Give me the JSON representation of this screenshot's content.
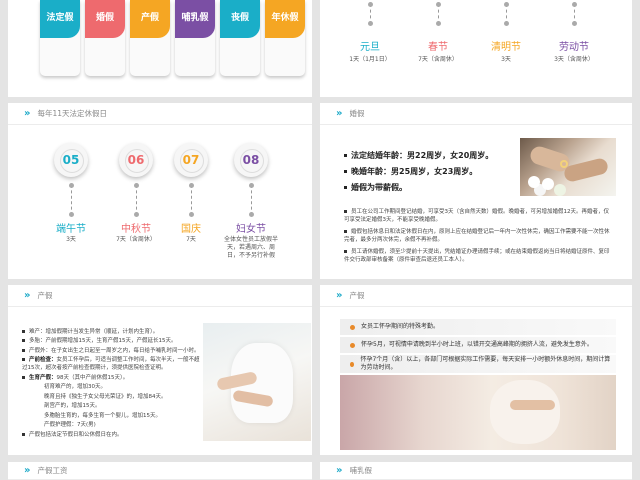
{
  "slide1": {
    "tags": [
      {
        "label": "法定假",
        "color": "#1aaec8"
      },
      {
        "label": "婚假",
        "color": "#ee6a6e"
      },
      {
        "label": "产假",
        "color": "#f5a623"
      },
      {
        "label": "哺乳假",
        "color": "#7b4fa4"
      },
      {
        "label": "丧假",
        "color": "#1aaec8"
      },
      {
        "label": "年休假",
        "color": "#f5a623"
      }
    ]
  },
  "slide2": {
    "holidays": [
      {
        "name": "元旦",
        "desc": "1天（1月1日）",
        "color": "#1aaec8"
      },
      {
        "name": "春节",
        "desc": "7天（含周休）",
        "color": "#ee6a6e"
      },
      {
        "name": "清明节",
        "desc": "3天",
        "color": "#f5a623"
      },
      {
        "name": "劳动节",
        "desc": "3天（含周休）",
        "color": "#7b4fa4"
      }
    ]
  },
  "slide3": {
    "title": "每年11天法定休假日",
    "items": [
      {
        "num": "05",
        "name": "端午节",
        "desc": "3天",
        "color": "#1aaec8"
      },
      {
        "num": "06",
        "name": "中秋节",
        "desc": "7天（含周休）",
        "color": "#ee6a6e"
      },
      {
        "num": "07",
        "name": "国庆",
        "desc": "7天",
        "color": "#f5a623"
      },
      {
        "num": "08",
        "name": "妇女节",
        "desc": "全体女性员工放假半天，若遇周六、周日，不予另行补假",
        "color": "#7b4fa4"
      }
    ]
  },
  "slide4": {
    "title": "婚假",
    "legal": [
      "法定结婚年龄：男22周岁，女20周岁。",
      "晚婚年龄：男25周岁，女23周岁。",
      "婚假为带薪假。"
    ],
    "paras": [
      "员工在公司工作期间登记结婚，可享受3天（含自然天数）婚假。晚婚者，可另增加婚假12天。再婚者，仅可享受法定婚假3天，不能享受晚婚假。",
      "婚假包括休息日和法定休假日在内，原则上应在结婚登记后一年内一次性休完，确因工作需要不能一次性休完者，最多分两次休完，余假不再补假。",
      "员工请休婚假，须至少提前十天提出，凭结婚证办理请假手续；或在结束婚假返岗当日将结婚证原件、复印件交行政部审核备案（原件审查后退还员工本人）。"
    ]
  },
  "slide5": {
    "title": "产假",
    "lines": [
      {
        "bold": "",
        "text": "难产：增加假期计当发生异常（顺延，计划内生育）。"
      },
      {
        "bold": "",
        "text": "多胎：产前假期增加15天，生育产假15天，产假延长15天。"
      },
      {
        "bold": "",
        "text": "产假外：在子女出生之日起至一周岁之内，每日给予哺乳时间一小时。"
      },
      {
        "bold": "产前检查：",
        "text": "女员工怀孕后，可适当调整工作时间，每次半天，一般不超过15次，超次者按产前检查假期计，须提供医院检查证明。"
      },
      {
        "bold": "生育产假：",
        "text": "98天（其中产前休假15天）。"
      },
      {
        "bold": "",
        "text": "　　　　初育难产的，增加30天。"
      },
      {
        "bold": "",
        "text": "　　　　晚育且持《独生子女父母光荣证》的，增加84天。"
      },
      {
        "bold": "",
        "text": "　　　　剖宫产的，增加15天。"
      },
      {
        "bold": "",
        "text": "　　　　多胞胎生育的，每多生育一个婴儿，增加15天。"
      },
      {
        "bold": "",
        "text": "　　　　产假护理假：7天(男)"
      },
      {
        "bold": "",
        "text": "产假包括法定节假日和公休假日在内。"
      }
    ]
  },
  "slide6": {
    "title": "产假",
    "items": [
      "女员工怀孕期间的特殊考勤。",
      "怀孕5月，可视情申请晚到半小时上班，以错开交通高峰期的拥挤人流，避免发生意外。",
      "怀孕7个月（含）以上，各部门可根据实际工作需要，每天安排一小时额外休息时间，期间计算为劳动时间。"
    ]
  },
  "slide7": {
    "title": "产假工资"
  },
  "slide8": {
    "title": "哺乳假"
  }
}
